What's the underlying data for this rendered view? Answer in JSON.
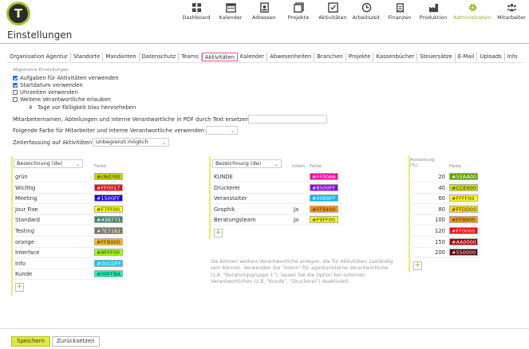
{
  "nav": [
    {
      "label": "Dashboard",
      "icon": "dashboard-icon"
    },
    {
      "label": "Kalender",
      "icon": "calendar-icon"
    },
    {
      "label": "Adressen",
      "icon": "address-book-icon"
    },
    {
      "label": "Projekte",
      "icon": "projects-icon"
    },
    {
      "label": "Aktivitäten",
      "icon": "activities-icon"
    },
    {
      "label": "Arbeitszeit",
      "icon": "clock-icon"
    },
    {
      "label": "Finanzen",
      "icon": "finance-icon"
    },
    {
      "label": "Produktion",
      "icon": "production-icon"
    },
    {
      "label": "Administration",
      "icon": "gear-icon",
      "active": true
    },
    {
      "label": "Mitarbeiter",
      "icon": "people-icon"
    }
  ],
  "accent_color": "#8fb11b",
  "logo_letter": "T",
  "page_title": "Einstellungen",
  "tabs": [
    "Organisation Agentur",
    "Standorte",
    "Mandanten",
    "Datenschutz",
    "Teams",
    "Aktivitäten",
    "Kalender",
    "Abwesenheiten",
    "Branchen",
    "Projekte",
    "Kassenbücher",
    "Steuersätze",
    "E-Mail",
    "Uploads",
    "Info"
  ],
  "active_tab": "Aktivitäten",
  "general": {
    "heading": "Allgemeine Einstellungen",
    "checkboxes": [
      {
        "label": "Aufgaben für Aktivitäten verwenden",
        "checked": true
      },
      {
        "label": "Startdatum verwenden",
        "checked": true
      },
      {
        "label": "Uhrzeiten verwenden",
        "checked": false
      },
      {
        "label": "Weitere Verantwortliche erlauben",
        "checked": false
      }
    ],
    "due_days": "4",
    "due_text": "Tage vor Fälligkeit blau hervorheben",
    "replace_text": "Mitarbeiternamen, Abteilungen und interne Verantwortliche in PDF durch Text ersetzen",
    "color_text": "Folgende Farbe für Mitarbeiter und interne Verantwortliche verwenden",
    "time_text": "Zeiterfassung auf Aktivitäten",
    "time_value": "Unbegrenzt möglich"
  },
  "table1": {
    "select": "Bezeichnung (de)",
    "col_color": "Farbe",
    "rows": [
      {
        "label": "grün",
        "color": "#c8d700"
      },
      {
        "label": "Wichtig",
        "color": "#FF0017"
      },
      {
        "label": "Meeting",
        "color": "#1500FF"
      },
      {
        "label": "Jour Fixe",
        "color": "#F7FF00"
      },
      {
        "label": "Standard",
        "color": "#438771"
      },
      {
        "label": "Testing",
        "color": "#7E7162"
      },
      {
        "label": "orange",
        "color": "#FFB900"
      },
      {
        "label": "Interface",
        "color": "#9FFF00"
      },
      {
        "label": "Info",
        "color": "#00CDFF"
      },
      {
        "label": "Kunde",
        "color": "#00FFBA"
      }
    ]
  },
  "table2": {
    "select": "Bezeichnung (de)",
    "col_intern": "Intern",
    "col_color": "Farbe",
    "rows": [
      {
        "label": "KUNDE",
        "intern": "",
        "color": "#FF00A6"
      },
      {
        "label": "Druckerei",
        "intern": "",
        "color": "#8500FF"
      },
      {
        "label": "Veranstalter",
        "intern": "",
        "color": "#00B9FF"
      },
      {
        "label": "Graphik",
        "intern": "Ja",
        "color": "#FF9400"
      },
      {
        "label": "Beratungsteam",
        "intern": "Ja",
        "color": "#F9FF00"
      }
    ],
    "note": "Sie können weitere Verantwortliche anlegen, die für Aktivitäten zuständig sein können. Verwenden Sie \"intern\" für agenturinterne Verantwortliche (z.B. \"Beratungsgruppe 1\"), lassen Sie die Option bei externen Verantwortlichen (z.B. \"Kunde\", \"Druckerei\") deaktiviert."
  },
  "table3": {
    "col_load_1": "Auslastung",
    "col_load_2": "(%)",
    "col_color": "Farbe",
    "rows": [
      {
        "value": "20",
        "color": "#55AA00"
      },
      {
        "value": "40",
        "color": "#CCE600"
      },
      {
        "value": "60",
        "color": "#FFFF00"
      },
      {
        "value": "80",
        "color": "#FFDD00"
      },
      {
        "value": "100",
        "color": "#FF9900"
      },
      {
        "value": "120",
        "color": "#FF0000"
      },
      {
        "value": "150",
        "color": "#AA0000"
      },
      {
        "value": "200",
        "color": "#550000"
      }
    ]
  },
  "buttons": {
    "save": "Speichern",
    "reset": "Zurücksetzen"
  }
}
